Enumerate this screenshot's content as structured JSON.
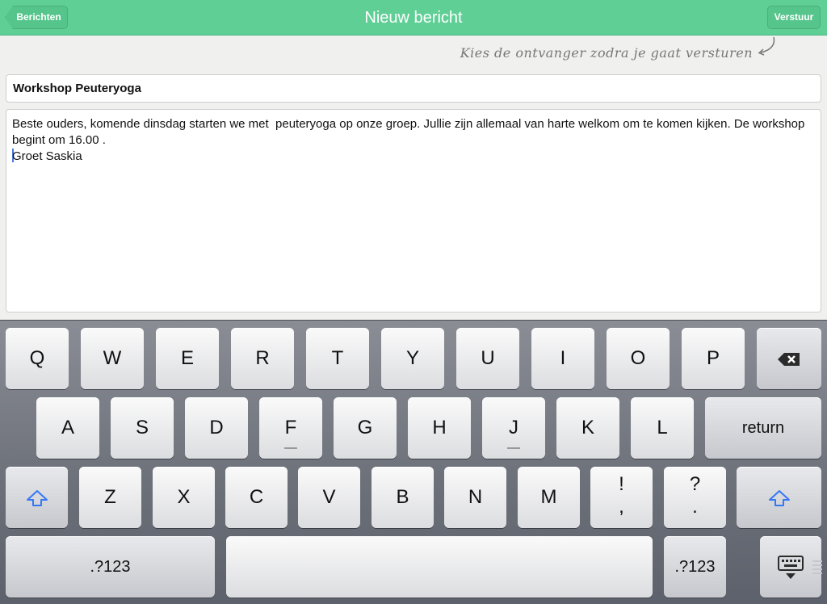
{
  "nav": {
    "back_label": "Berichten",
    "title": "Nieuw bericht",
    "send_label": "Verstuur"
  },
  "hint": "Kies de ontvanger zodra je gaat versturen",
  "form": {
    "subject": "Workshop Peuteryoga",
    "body_line1": "Beste ouders, komende dinsdag starten we met  peuteryoga op onze groep. Jullie zijn allemaal van harte welkom om te komen kijken. De workshop begint om 16.00 .",
    "body_line2": "Groet Saskia"
  },
  "keyboard": {
    "row1": [
      "Q",
      "W",
      "E",
      "R",
      "T",
      "Y",
      "U",
      "I",
      "O",
      "P"
    ],
    "row2": [
      "A",
      "S",
      "D",
      "F",
      "G",
      "H",
      "J",
      "K",
      "L"
    ],
    "return_label": "return",
    "row3": [
      "Z",
      "X",
      "C",
      "V",
      "B",
      "N",
      "M"
    ],
    "punct1": [
      "!",
      ","
    ],
    "punct2": [
      "?",
      "."
    ],
    "numbers_label": ".?123",
    "icons": {
      "backspace": "backspace-icon",
      "shift": "shift-icon",
      "hide": "keyboard-hide-icon"
    }
  },
  "colors": {
    "navbar": "#5fcf96",
    "caret": "#4a7bd8",
    "shift_accent": "#3478f6"
  }
}
